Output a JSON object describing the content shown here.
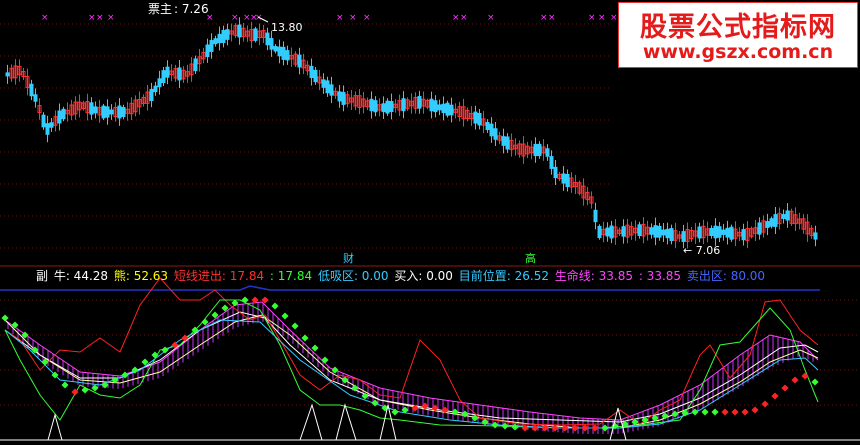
{
  "main": {
    "title_prefix": "票主",
    "title_value": ": 7.26",
    "high_label": "13.80",
    "low_label": "← 7.06",
    "marker_left": "财",
    "marker_right": "高"
  },
  "sub": {
    "label": "副",
    "items": [
      {
        "label": "牛: 44.28",
        "color": "#ffffff"
      },
      {
        "label": "熊: 52.63",
        "color": "#ffff00"
      },
      {
        "label": "短线进出: 17.84",
        "color": "#ff3030"
      },
      {
        "label": ": 17.84",
        "color": "#33ff33"
      },
      {
        "label": "低吸区: 0.00",
        "color": "#33ccff"
      },
      {
        "label": "买入: 0.00",
        "color": "#ffffff"
      },
      {
        "label": "目前位置: 26.52",
        "color": "#33ccff"
      },
      {
        "label": "生命线: 33.85",
        "color": "#ff44ff"
      },
      {
        "label": ": 33.85",
        "color": "#ff44ff"
      },
      {
        "label": "卖出区: 80.00",
        "color": "#4466ff"
      }
    ]
  },
  "watermark": {
    "title": "股票公式指标网",
    "url": "www.gszx.com.cn"
  },
  "colors": {
    "up": "#ff3333",
    "down": "#33ccff",
    "grid": "#6b1010",
    "marker": "#ff33ff",
    "sell_line": "#2233cc"
  }
}
